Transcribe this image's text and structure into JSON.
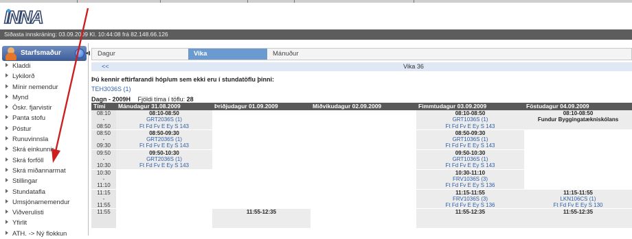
{
  "app": {
    "logo_text": "INNA"
  },
  "login_info": "Síðasta innskráning: 03.09.2009 Kl. 10:44:08 frá 82.148.66.126",
  "sidebar": {
    "role": "Starfsmaður",
    "items": [
      {
        "label": "Kladdi"
      },
      {
        "label": "Lykilorð"
      },
      {
        "label": "Mínir nemendur"
      },
      {
        "label": "Mynd"
      },
      {
        "label": "Óskr. fjarvistir"
      },
      {
        "label": "Panta stofu"
      },
      {
        "label": "Póstur"
      },
      {
        "label": "Runuvinnsla"
      },
      {
        "label": "Skrá einkunnir"
      },
      {
        "label": "Skrá forföll"
      },
      {
        "label": "Skrá miðannarmat"
      },
      {
        "label": "Stillingar"
      },
      {
        "label": "Stundatafla"
      },
      {
        "label": "Umsjónarnemendur"
      },
      {
        "label": "Viðverulisti"
      },
      {
        "label": "Yfirlit"
      },
      {
        "label": "ATH. -> Ný flokkun"
      }
    ]
  },
  "tabs": [
    {
      "label": "Dagur"
    },
    {
      "label": "Vika"
    },
    {
      "label": "Mánuður"
    }
  ],
  "week_nav": {
    "prev": "<<",
    "week_label": "Vika 36"
  },
  "info": {
    "not_in_table": "Þú kennir eftirfarandi hóp/um sem ekki eru í stundatöflu þinni:",
    "group_link": "TEH3036S (1)",
    "term": "Dagn - 2009H",
    "hours_label": "Fjöldi tíma í töflu:",
    "hours_value": "28"
  },
  "schedule": {
    "headers": [
      "Tími",
      "Mánudagur 31.08.2009",
      "Þriðjudagur 01.09.2009",
      "Miðvikudagur 02.09.2009",
      "Fimmtudagur 03.09.2009",
      "Föstudagur 04.09.2009"
    ],
    "slots": [
      {
        "start": "08:10",
        "end": "08:50",
        "cells": [
          {
            "time": "08:10-08:50",
            "group": "GRT2036S (1)",
            "room": "Ft Fd Fv E Ey S 143"
          },
          null,
          null,
          {
            "time": "08:10-08:50",
            "group": "GRT1036S (1)",
            "room": "Ft Fd Fv E Ey S 143"
          },
          {
            "time": "08:10-08:50",
            "group": "Fundur Byggingatækniskólans",
            "room": ""
          }
        ]
      },
      {
        "start": "08:50",
        "end": "09:30",
        "cells": [
          {
            "time": "08:50-09:30",
            "group": "GRT2036S (1)",
            "room": "Ft Fd Fv E Ey S 143"
          },
          null,
          null,
          {
            "time": "08:50-09:30",
            "group": "GRT1036S (1)",
            "room": "Ft Fd Fv E Ey S 143"
          },
          null
        ]
      },
      {
        "start": "09:50",
        "end": "10:30",
        "cells": [
          {
            "time": "09:50-10:30",
            "group": "GRT2036S (1)",
            "room": "Ft Fd Fv E Ey S 143"
          },
          null,
          null,
          {
            "time": "09:50-10:30",
            "group": "GRT1036S (1)",
            "room": "Ft Fd Fv E Ey S 143"
          },
          null
        ]
      },
      {
        "start": "10:30",
        "end": "11:10",
        "cells": [
          null,
          null,
          null,
          {
            "time": "10:30-11:10",
            "group": "FRV1036S (3)",
            "room": "Ft Fd Fv E Ey S 136"
          },
          null
        ]
      },
      {
        "start": "11:15",
        "end": "11:55",
        "cells": [
          null,
          null,
          null,
          {
            "time": "11:15-11:55",
            "group": "FRV1036S (3)",
            "room": "Ft Fd Fv E Ey S 136"
          },
          {
            "time": "11:15-11:55",
            "group": "LKN106CS (1)",
            "room": "Ft Fd Fv E Ey S 130"
          }
        ]
      },
      {
        "start": "11:55",
        "end": "",
        "cells": [
          null,
          {
            "time": "11:55-12:35",
            "group": "",
            "room": ""
          },
          null,
          {
            "time": "11:55-12:35",
            "group": "",
            "room": ""
          },
          {
            "time": "11:55-12:35",
            "group": "",
            "room": ""
          }
        ]
      }
    ]
  },
  "colors": {
    "header_bg": "#595959",
    "tab_active": "#6b9ad1",
    "link": "#2d5fa8",
    "arrow": "#cc1f1f"
  },
  "icons": [
    "user-icon",
    "help-icon",
    "collapse-icon",
    "menu-bullet-icon",
    "annotation-arrow"
  ]
}
